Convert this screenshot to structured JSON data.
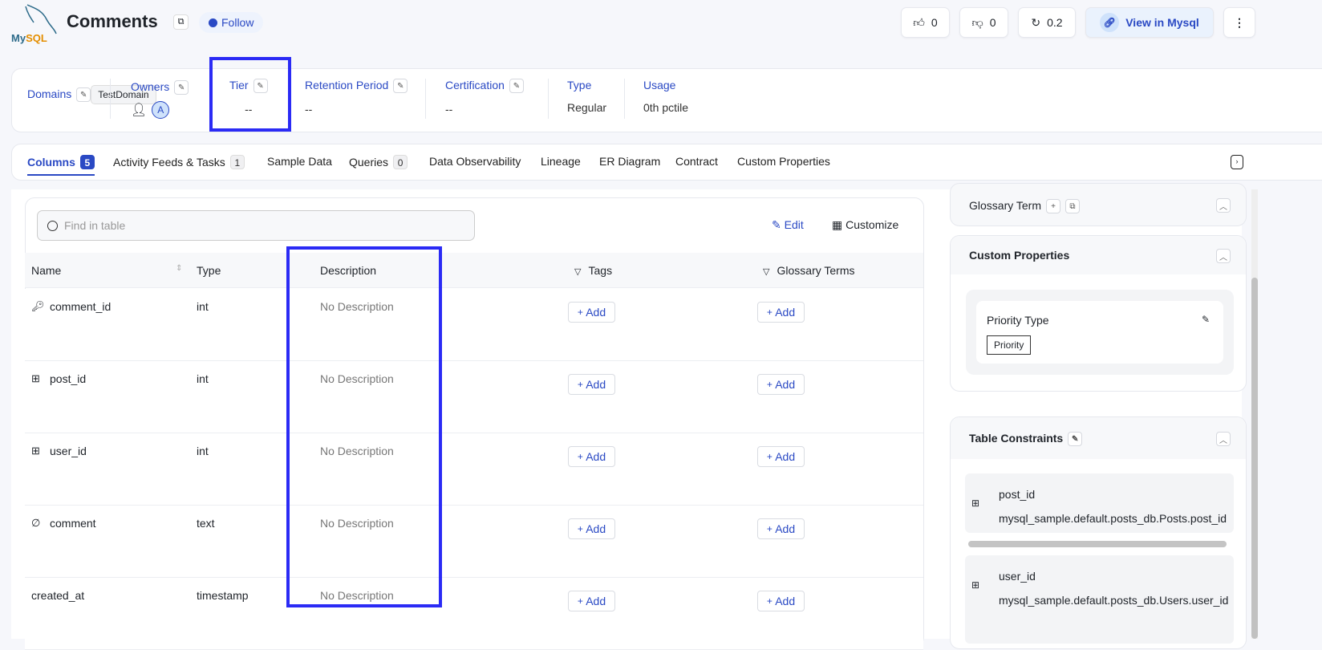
{
  "header": {
    "logo_text": "MySQL",
    "title": "Comments",
    "follow_label": "Follow",
    "likes": "0",
    "dislikes": "0",
    "version": "0.2",
    "view_label": "View in Mysql"
  },
  "props": {
    "domains_label": "Domains",
    "domain_value": "TestDomain",
    "owners_label": "Owners",
    "owner_avatar": "A",
    "tier_label": "Tier",
    "tier_value": "--",
    "retention_label": "Retention Period",
    "retention_value": "--",
    "cert_label": "Certification",
    "cert_value": "--",
    "type_label": "Type",
    "type_value": "Regular",
    "usage_label": "Usage",
    "usage_value": "0th pctile"
  },
  "tabs": [
    {
      "label": "Columns",
      "count": "5"
    },
    {
      "label": "Activity Feeds & Tasks",
      "count": "1"
    },
    {
      "label": "Sample Data"
    },
    {
      "label": "Queries",
      "count": "0"
    },
    {
      "label": "Data Observability"
    },
    {
      "label": "Lineage"
    },
    {
      "label": "ER Diagram"
    },
    {
      "label": "Contract"
    },
    {
      "label": "Custom Properties"
    }
  ],
  "table": {
    "search_placeholder": "Find in table",
    "edit_label": "Edit",
    "customize_label": "Customize",
    "headers": [
      "Name",
      "Type",
      "Description",
      "Tags",
      "Glossary Terms"
    ],
    "add_label": "Add",
    "rows": [
      {
        "name": "comment_id",
        "type": "int",
        "desc": "No Description"
      },
      {
        "name": "post_id",
        "type": "int",
        "desc": "No Description"
      },
      {
        "name": "user_id",
        "type": "int",
        "desc": "No Description"
      },
      {
        "name": "comment",
        "type": "text",
        "desc": "No Description"
      },
      {
        "name": "created_at",
        "type": "timestamp",
        "desc": "No Description"
      }
    ]
  },
  "side": {
    "glossary_label": "Glossary Term",
    "custom_label": "Custom Properties",
    "priority_label": "Priority Type",
    "priority_value": "Priority",
    "constraints_label": "Table Constraints",
    "constraints": [
      {
        "column": "post_id",
        "ref": "mysql_sample.default.posts_db.Posts.post_id"
      },
      {
        "column": "user_id",
        "ref": "mysql_sample.default.posts_db.Users.user_id"
      }
    ]
  }
}
